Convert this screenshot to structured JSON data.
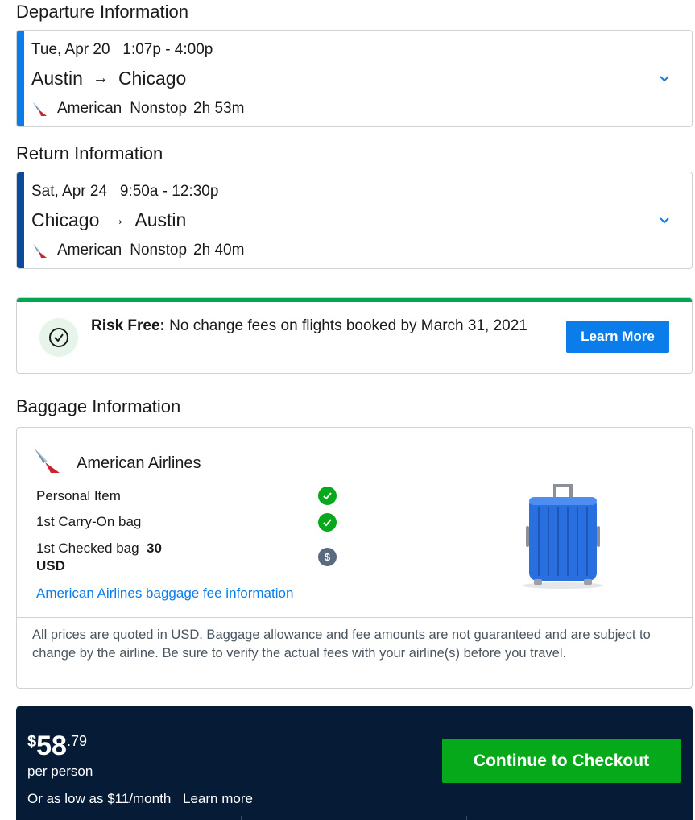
{
  "departure": {
    "section_title": "Departure Information",
    "date": "Tue, Apr 20",
    "time": "1:07p - 4:00p",
    "from": "Austin",
    "to": "Chicago",
    "airline": "American",
    "stops": "Nonstop",
    "duration": "2h 53m",
    "accent_color": "#0a7dea"
  },
  "return": {
    "section_title": "Return Information",
    "date": "Sat, Apr 24",
    "time": "9:50a - 12:30p",
    "from": "Chicago",
    "to": "Austin",
    "airline": "American",
    "stops": "Nonstop",
    "duration": "2h 40m",
    "accent_color": "#0b4a9c"
  },
  "risk_free": {
    "label": "Risk Free:",
    "text": " No change fees on flights booked by March 31, 2021",
    "button_label": "Learn More"
  },
  "baggage": {
    "section_title": "Baggage Information",
    "airline_name": "American Airlines",
    "items": [
      {
        "label": "Personal Item",
        "status": "included"
      },
      {
        "label": "1st Carry-On bag",
        "status": "included"
      },
      {
        "label": "1st Checked bag",
        "fee": "30",
        "fee_unit": "USD",
        "status": "fee"
      }
    ],
    "link_text": "American Airlines baggage fee information",
    "note": "All prices are quoted in USD. Baggage allowance and fee amounts are not guaranteed and are subject to change by the airline. Be sure to verify the actual fees with your airline(s) before you travel."
  },
  "checkout": {
    "currency_symbol": "$",
    "price_dollars": "58",
    "price_cents": ".79",
    "per_person": "per person",
    "monthly_text": "Or as low as $11/month",
    "learn_more": "Learn more",
    "button_label": "Continue to Checkout"
  },
  "colors": {
    "brand_blue": "#0a7dea",
    "success_green": "#06a919",
    "dark_navy": "#051b36"
  }
}
